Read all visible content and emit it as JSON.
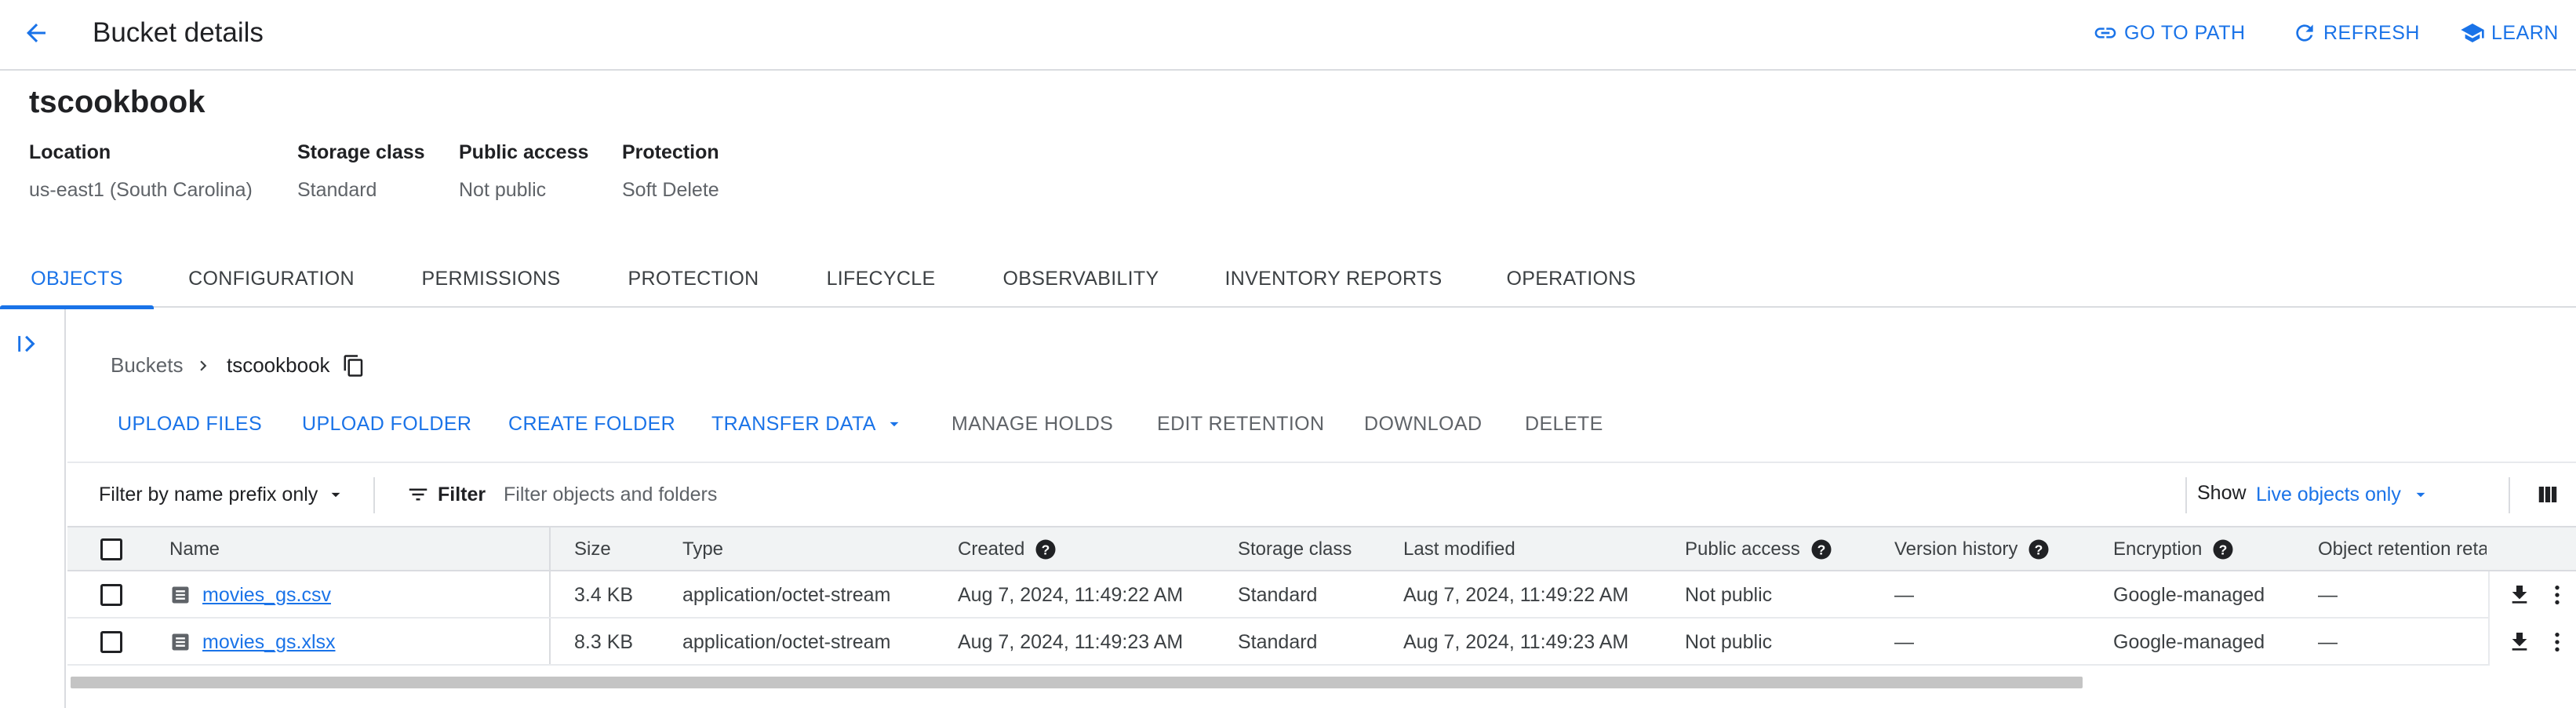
{
  "header": {
    "title": "Bucket details",
    "actions": [
      {
        "label": "GO TO PATH",
        "icon": "link-icon"
      },
      {
        "label": "REFRESH",
        "icon": "refresh-icon"
      },
      {
        "label": "LEARN",
        "icon": "school-icon"
      }
    ]
  },
  "bucket": {
    "name": "tscookbook",
    "meta": [
      {
        "label": "Location",
        "value": "us-east1 (South Carolina)"
      },
      {
        "label": "Storage class",
        "value": "Standard"
      },
      {
        "label": "Public access",
        "value": "Not public"
      },
      {
        "label": "Protection",
        "value": "Soft Delete"
      }
    ]
  },
  "tabs": [
    {
      "label": "OBJECTS",
      "active": true
    },
    {
      "label": "CONFIGURATION",
      "active": false
    },
    {
      "label": "PERMISSIONS",
      "active": false
    },
    {
      "label": "PROTECTION",
      "active": false
    },
    {
      "label": "LIFECYCLE",
      "active": false
    },
    {
      "label": "OBSERVABILITY",
      "active": false
    },
    {
      "label": "INVENTORY REPORTS",
      "active": false
    },
    {
      "label": "OPERATIONS",
      "active": false
    }
  ],
  "breadcrumb": {
    "root": "Buckets",
    "current": "tscookbook"
  },
  "toolbar": {
    "upload_files": "UPLOAD FILES",
    "upload_folder": "UPLOAD FOLDER",
    "create_folder": "CREATE FOLDER",
    "transfer_data": "TRANSFER DATA",
    "manage_holds": "MANAGE HOLDS",
    "edit_retention": "EDIT RETENTION",
    "download": "DOWNLOAD",
    "delete": "DELETE"
  },
  "filter": {
    "prefix_mode": "Filter by name prefix only",
    "filter_label": "Filter",
    "placeholder": "Filter objects and folders",
    "show_label": "Show",
    "show_value": "Live objects only"
  },
  "table": {
    "columns": [
      "Name",
      "Size",
      "Type",
      "Created",
      "Storage class",
      "Last modified",
      "Public access",
      "Version history",
      "Encryption",
      "Object retention retain"
    ],
    "rows": [
      {
        "name": "movies_gs.csv",
        "size": "3.4 KB",
        "type": "application/octet-stream",
        "created": "Aug 7, 2024, 11:49:22 AM",
        "storage_class": "Standard",
        "last_modified": "Aug 7, 2024, 11:49:22 AM",
        "public_access": "Not public",
        "version_history": "—",
        "encryption": "Google-managed",
        "retention": "—"
      },
      {
        "name": "movies_gs.xlsx",
        "size": "8.3 KB",
        "type": "application/octet-stream",
        "created": "Aug 7, 2024, 11:49:23 AM",
        "storage_class": "Standard",
        "last_modified": "Aug 7, 2024, 11:49:23 AM",
        "public_access": "Not public",
        "version_history": "—",
        "encryption": "Google-managed",
        "retention": "—"
      }
    ]
  },
  "colors": {
    "accent": "#1a73e8",
    "text": "#202124",
    "muted": "#5f6368",
    "divider": "#dadce0",
    "header_bg": "#f1f3f4"
  }
}
